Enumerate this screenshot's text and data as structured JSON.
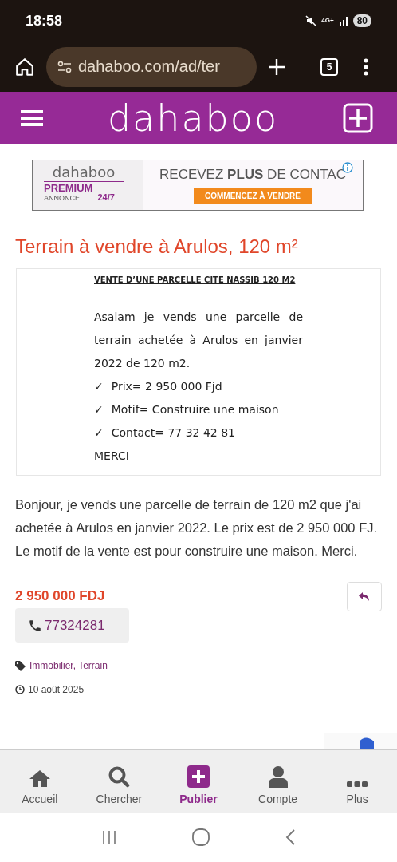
{
  "status_bar": {
    "time": "18:58",
    "network": "4G+",
    "battery": "80"
  },
  "browser": {
    "url": "dahaboo.com/ad/ter",
    "tab_count": "5"
  },
  "site_header": {
    "logo": "dahaboo"
  },
  "ad_banner": {
    "logo": "dahaboo",
    "premium": "PREMIUM",
    "annonce": "ANNONCE",
    "hours": "24/7",
    "headline": "RECEVEZ **PLUS** DE CONTAC",
    "cta": "COMMENCEZ À VENDRE"
  },
  "listing": {
    "title": "Terrain à vendre à Arulos, 120 m²",
    "document": {
      "heading": "VENTE D’UNE PARCELLE CITE NASSIB 120 M2",
      "body": "Asalam je vends une parcelle de terrain achetée à Arulos en janvier 2022 de 120 m2.",
      "bullets": [
        "Prix= 2 950 000 Fjd",
        "Motif= Construire une maison",
        "Contact=  77 32 42 81"
      ],
      "bullet_mark": "✓",
      "closing": "MERCI"
    },
    "description": "Bonjour, je vends une parcelle de terrain de 120 m2 que j'ai achetée à Arulos en janvier 2022. Le prix est de 2 950 000 FJ. Le motif de la vente est pour construire une maison. Merci.",
    "price": "2 950 000 FDJ",
    "phone": "77324281",
    "categories": "Immobilier, Terrain",
    "date": "10 août 2025"
  },
  "bottom_nav": [
    {
      "label": "Accueil",
      "selected": false
    },
    {
      "label": "Chercher",
      "selected": false
    },
    {
      "label": "Publier",
      "selected": true
    },
    {
      "label": "Compte",
      "selected": false
    },
    {
      "label": "Plus",
      "selected": false
    }
  ]
}
